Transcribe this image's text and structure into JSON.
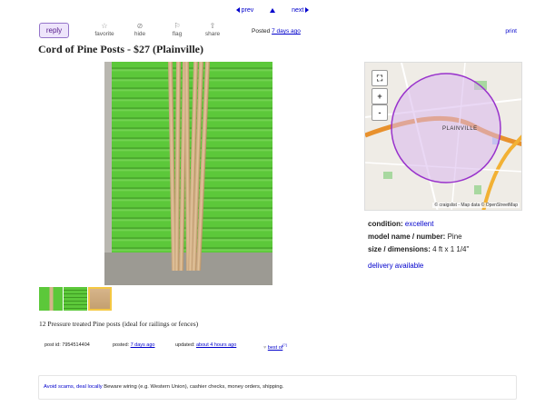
{
  "nav": {
    "prev": "prev",
    "next": "next"
  },
  "actions": {
    "reply": "reply",
    "favorite": "favorite",
    "hide": "hide",
    "flag": "flag",
    "share": "share"
  },
  "posted": {
    "label": "Posted",
    "value": "7 days ago"
  },
  "print": "print",
  "title": "Cord of Pine Posts - $27 (Plainville)",
  "map": {
    "place_label": "PLAINVILLE",
    "credit": "© craigslist - Map data © OpenStreetMap",
    "zoom_in": "+",
    "zoom_out": "-",
    "fullscreen": "⛶"
  },
  "attributes": {
    "condition_label": "condition:",
    "condition_value": "excellent",
    "model_label": "model name / number:",
    "model_value": "Pine",
    "size_label": "size / dimensions:",
    "size_value": "4 ft  x 1 1/4\""
  },
  "delivery": "delivery available",
  "description": "12 Pressure treated Pine posts (ideal for railings or fences)",
  "post_meta": {
    "post_id": "post id: 7954514404",
    "posted_label": "posted:",
    "posted_value": "7 days ago",
    "updated_label": "updated:",
    "updated_value": "about 4 hours ago",
    "best_of": "best of",
    "best_of_sup": "[?]"
  },
  "notice": {
    "avoid_scams": "Avoid scams, deal locally",
    "text": "Beware wiring (e.g. Western Union), cashier checks, money orders, shipping."
  },
  "colors": {
    "link": "#0000cc",
    "reply_border": "#9474c9",
    "map_circle": "#9933cc"
  }
}
